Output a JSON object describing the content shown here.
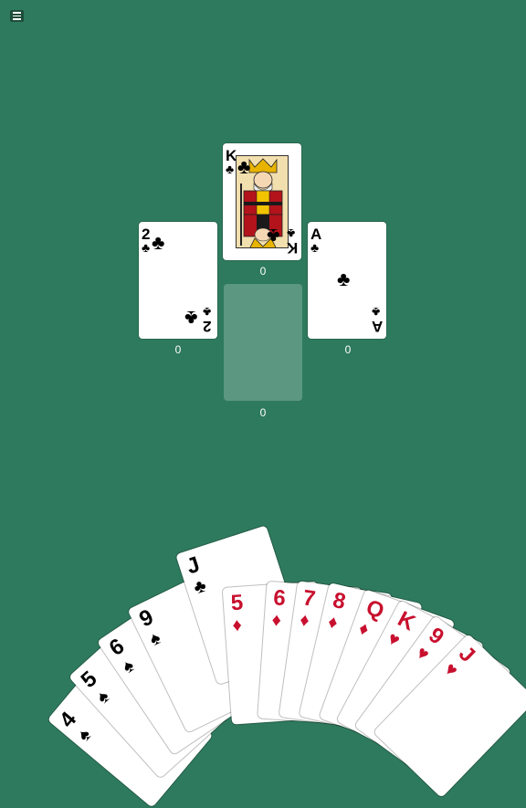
{
  "menu": {
    "icon": "hamburger-menu-icon"
  },
  "table": {
    "top": {
      "rank": "K",
      "suit": "♣",
      "score": "0"
    },
    "left": {
      "rank": "2",
      "suit": "♣",
      "score": "0"
    },
    "right": {
      "rank": "A",
      "suit": "♣",
      "score": "0"
    },
    "bottom": {
      "score": "0"
    }
  },
  "hand": [
    {
      "rank": "4",
      "suit": "♠",
      "color": "#000000"
    },
    {
      "rank": "5",
      "suit": "♠",
      "color": "#000000"
    },
    {
      "rank": "6",
      "suit": "♠",
      "color": "#000000"
    },
    {
      "rank": "9",
      "suit": "♠",
      "color": "#000000"
    },
    {
      "rank": "J",
      "suit": "♣",
      "color": "#000000"
    },
    {
      "rank": "5",
      "suit": "♦",
      "color": "#c8102e"
    },
    {
      "rank": "6",
      "suit": "♦",
      "color": "#c8102e"
    },
    {
      "rank": "7",
      "suit": "♦",
      "color": "#c8102e"
    },
    {
      "rank": "8",
      "suit": "♦",
      "color": "#c8102e"
    },
    {
      "rank": "Q",
      "suit": "♦",
      "color": "#c8102e"
    },
    {
      "rank": "K",
      "suit": "♥",
      "color": "#c8102e"
    },
    {
      "rank": "9",
      "suit": "♥",
      "color": "#c8102e"
    },
    {
      "rank": "J",
      "suit": "♥",
      "color": "#c8102e"
    }
  ],
  "colors": {
    "felt": "#2e7a5e",
    "red": "#c8102e",
    "black": "#000000"
  }
}
